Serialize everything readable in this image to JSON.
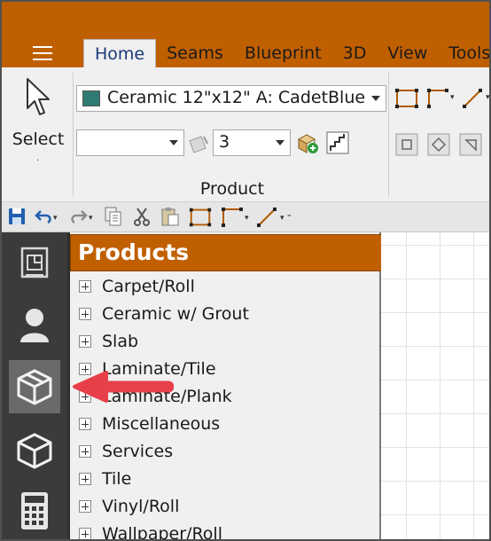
{
  "tabs": [
    "Home",
    "Seams",
    "Blueprint",
    "3D",
    "View",
    "Tools"
  ],
  "active_tab": "Home",
  "ribbon": {
    "select_label": "Select",
    "select_caret": "·",
    "product_combo_value": "Ceramic 12\"x12\" A: CadetBlue",
    "product_swatch_color": "#2f7c74",
    "style_combo_value": "",
    "number_combo_value": "3",
    "group_label": "Product"
  },
  "products_panel": {
    "title": "Products",
    "items": [
      "Carpet/Roll",
      "Ceramic w/ Grout",
      "Slab",
      "Laminate/Tile",
      "Laminate/Plank",
      "Miscellaneous",
      "Services",
      "Tile",
      "Vinyl/Roll",
      "Wallpaper/Roll"
    ]
  },
  "left_toolbar": [
    "blueprint-icon",
    "person-icon",
    "products-box-icon",
    "cube-icon",
    "calculator-icon"
  ],
  "colors": {
    "accent": "#c05f00",
    "annotation_arrow": "#e8404a"
  }
}
